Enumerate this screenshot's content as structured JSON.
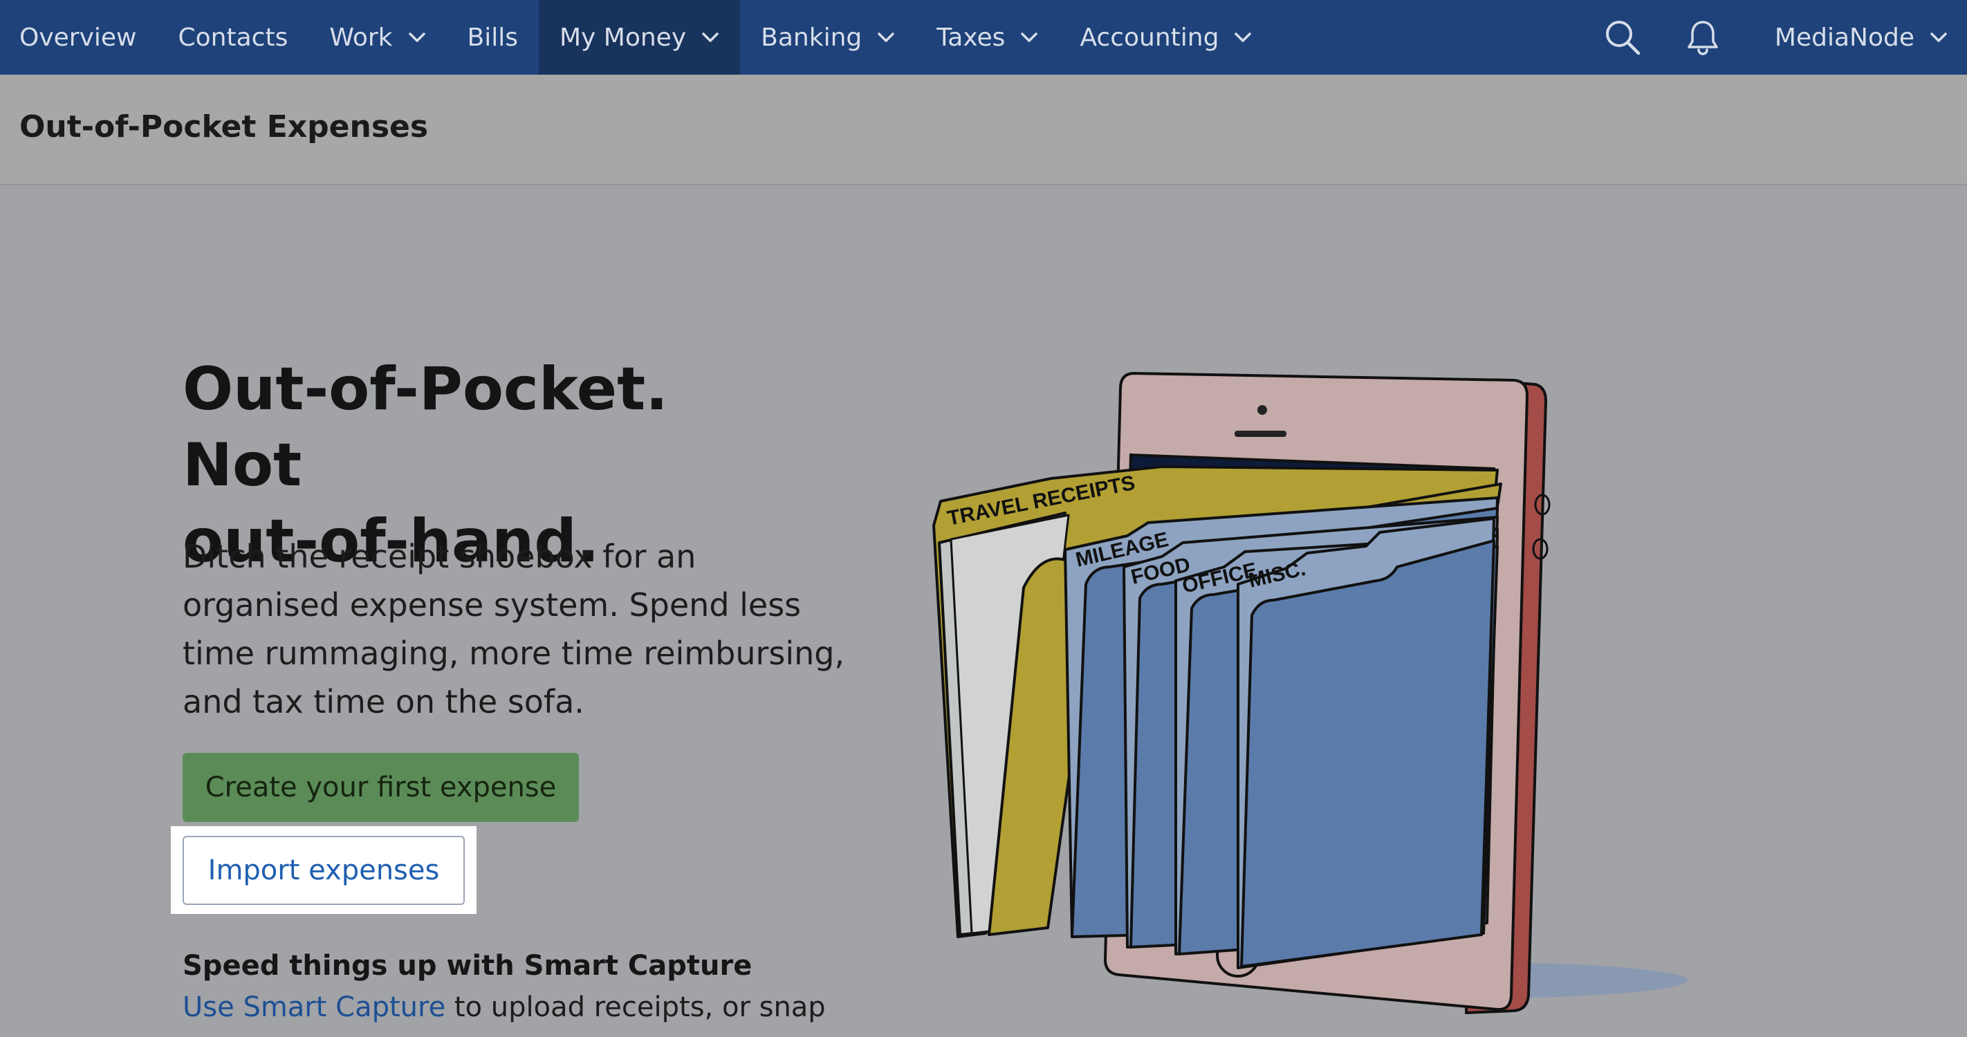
{
  "nav": {
    "items": [
      {
        "label": "Overview",
        "dropdown": false,
        "active": false
      },
      {
        "label": "Contacts",
        "dropdown": false,
        "active": false
      },
      {
        "label": "Work",
        "dropdown": true,
        "active": false
      },
      {
        "label": "Bills",
        "dropdown": false,
        "active": false
      },
      {
        "label": "My Money",
        "dropdown": true,
        "active": true
      },
      {
        "label": "Banking",
        "dropdown": true,
        "active": false
      },
      {
        "label": "Taxes",
        "dropdown": true,
        "active": false
      },
      {
        "label": "Accounting",
        "dropdown": true,
        "active": false
      }
    ],
    "search_icon": "search-icon",
    "notifications_icon": "bell-icon",
    "account_name": "MediaNode"
  },
  "page": {
    "title": "Out-of-Pocket Expenses"
  },
  "hero": {
    "heading_line1": "Out-of-Pocket. Not",
    "heading_line2": "out-of-hand.",
    "body_line1": "Ditch the receipt shoebox for an",
    "body_line2": "organised expense system. Spend less",
    "body_line3": "time rummaging, more time reimbursing,",
    "body_line4": "and tax time on the sofa.",
    "create_button": "Create your first expense",
    "import_button": "Import expenses"
  },
  "smart_capture": {
    "heading": "Speed things up with Smart Capture",
    "link": "Use Smart Capture",
    "text": " to upload receipts, or snap"
  },
  "illustration": {
    "folder_labels": [
      "TRAVEL RECEIPTS",
      "MILEAGE",
      "FOOD",
      "OFFICE",
      "MISC."
    ]
  },
  "colors": {
    "nav_bg": "#1e4279",
    "nav_active_bg": "#18335c",
    "page_bg": "#a1a3a7",
    "create_button": "#5b8c58",
    "link": "#1d4f93",
    "import_text": "#1f5fb0"
  }
}
